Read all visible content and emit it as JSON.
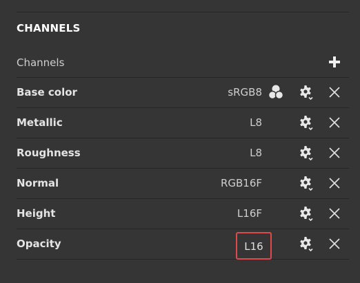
{
  "section": {
    "title": "CHANNELS"
  },
  "header": {
    "label": "Channels",
    "add_icon": "plus-icon"
  },
  "channels": [
    {
      "name": "Base color",
      "format": "sRGB8",
      "has_colorspace_icon": true
    },
    {
      "name": "Metallic",
      "format": "L8"
    },
    {
      "name": "Roughness",
      "format": "L8"
    },
    {
      "name": "Normal",
      "format": "RGB16F"
    },
    {
      "name": "Height",
      "format": "L16F"
    },
    {
      "name": "Opacity",
      "format": "L16",
      "highlighted": true
    }
  ],
  "icons": {
    "settings": "gear-dropdown-icon",
    "remove": "close-icon",
    "colorspace": "color-management-icon"
  },
  "colors": {
    "background": "#353535",
    "highlight": "#e04a4a"
  }
}
